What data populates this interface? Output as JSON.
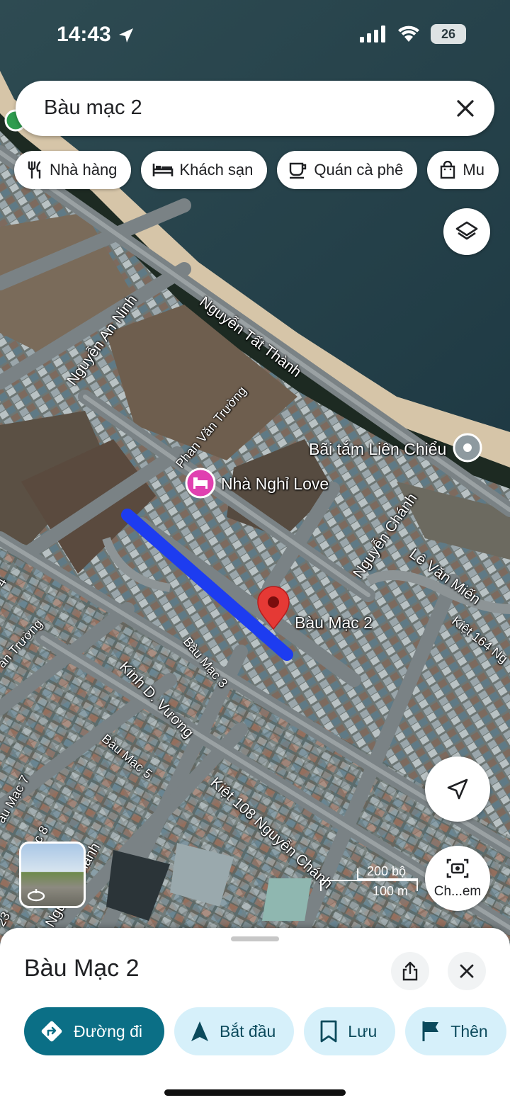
{
  "status_bar": {
    "time": "14:43",
    "battery": "26"
  },
  "search": {
    "query": "Bàu mạc 2"
  },
  "chips": [
    {
      "label": "Nhà hàng",
      "icon": "restaurant-icon"
    },
    {
      "label": "Khách sạn",
      "icon": "hotel-icon"
    },
    {
      "label": "Quán cà phê",
      "icon": "coffee-icon"
    },
    {
      "label": "Mu",
      "icon": "shopping-bag-icon"
    }
  ],
  "map": {
    "streets": {
      "nguyen_tat_thanh": "Nguyễn Tất Thành",
      "nguyen_an_ninh": "Nguyễn An Ninh",
      "phan_van_truong": "Phan Văn Trường",
      "nguyen_chanh": "Nguyễn Chánh",
      "le_van_mien": "Lê Văn Miến",
      "kiet_164": "Kiệt 164 Ng",
      "bau_mac_3": "Bàu Mạc 3",
      "kinh_d_vuong": "Kinh D. Vương",
      "bau_mac_5": "Bàu Mạc 5",
      "kiet_108": "Kiệt 108 Nguyễn Chánh",
      "van_truong": "ăn Trường",
      "bau_mac_7": "àu Mạc 7",
      "c8": "c 8",
      "nguyen_chanh_2": "Nguyễn Chánh",
      "n23": "23",
      "n4": "4"
    },
    "pois": {
      "beach": "Bãi tắm Liên Chiểu",
      "motel": "Nhà Nghỉ Love",
      "pin_label": "Bàu Mạc 2"
    },
    "scale": {
      "imperial": "200 bộ",
      "metric": "100 m"
    },
    "lens_label": "Ch...em"
  },
  "sheet": {
    "title": "Bàu Mạc 2",
    "actions": [
      {
        "label": "Đường đi",
        "icon": "directions-icon"
      },
      {
        "label": "Bắt đầu",
        "icon": "navigation-arrow-icon"
      },
      {
        "label": "Lưu",
        "icon": "bookmark-icon"
      },
      {
        "label": "Thên",
        "icon": "flag-icon"
      }
    ]
  },
  "colors": {
    "route": "#1d3cf0",
    "pin": "#e53935",
    "primary_action": "#0b6f86",
    "secondary_action": "#d6f0fa",
    "motel_pin": "#e040b0"
  }
}
